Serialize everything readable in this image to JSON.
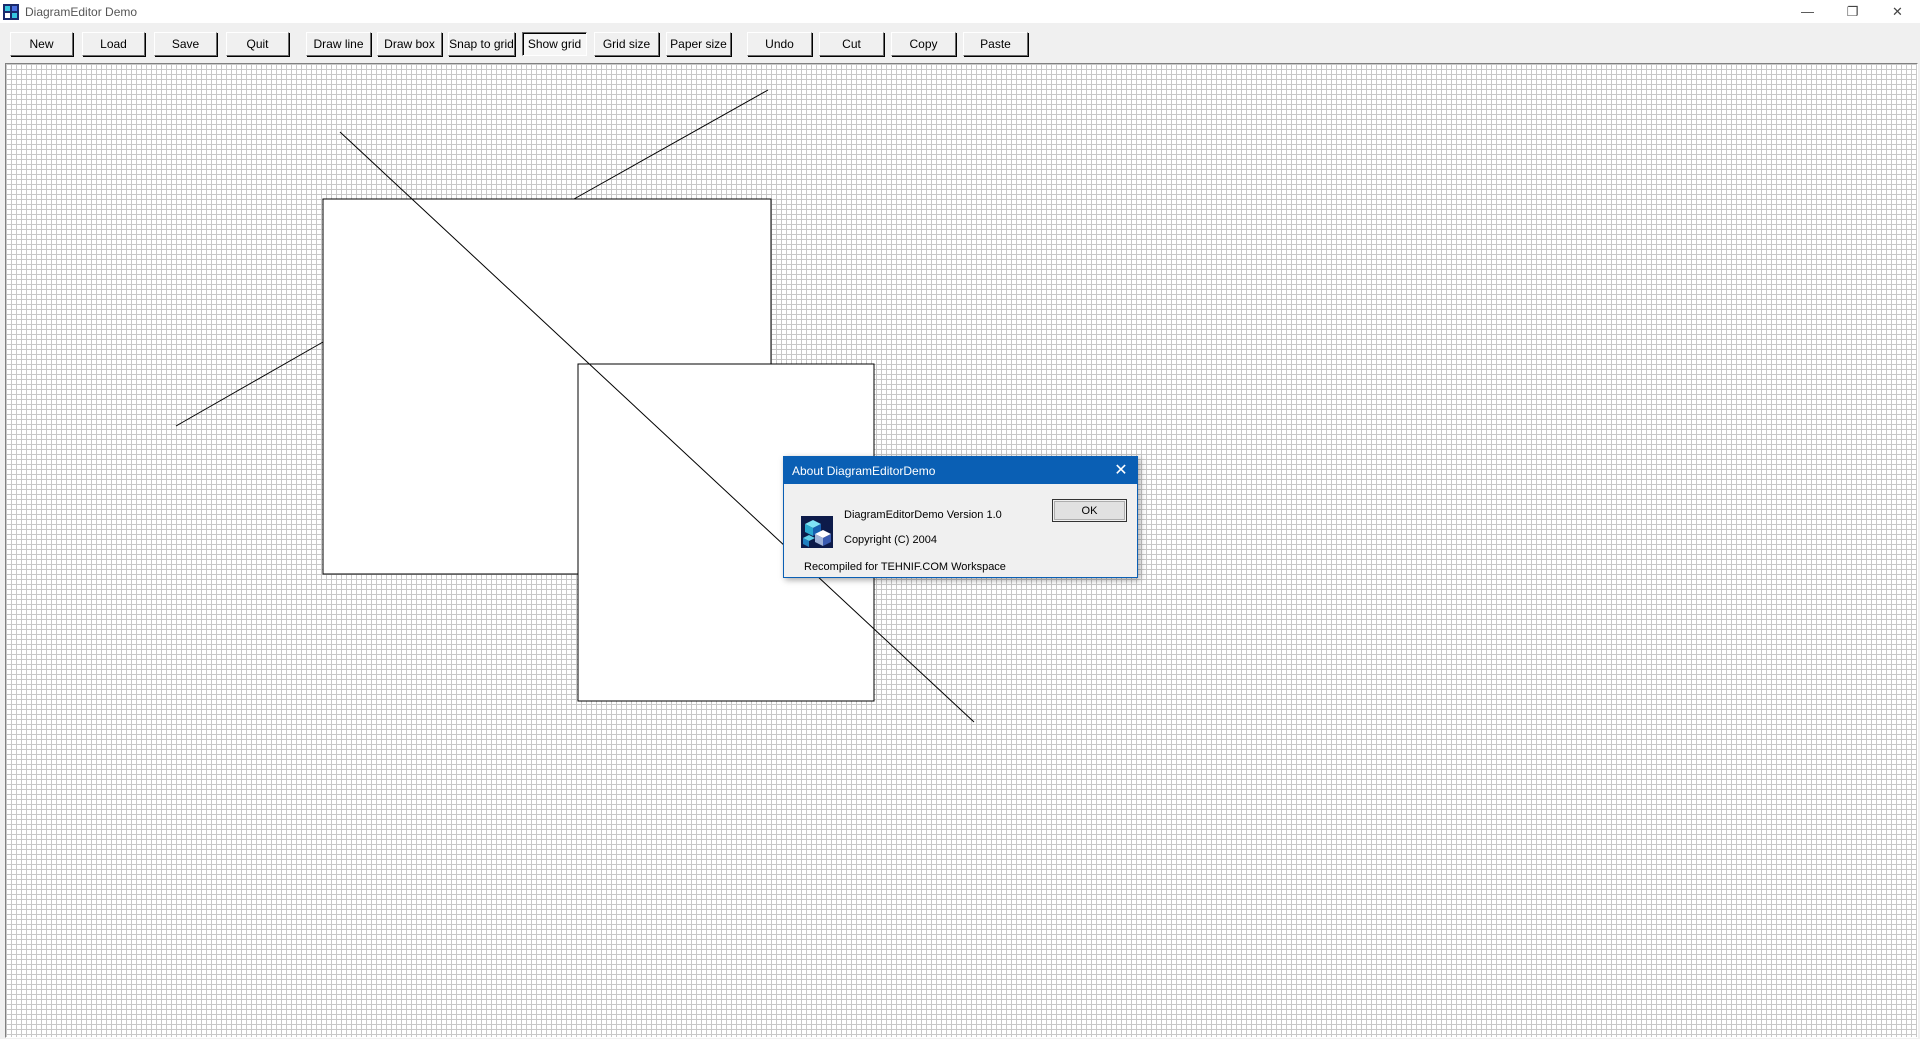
{
  "window": {
    "title": "DiagramEditor Demo",
    "caption": {
      "minimize": "—",
      "restore": "❐",
      "close": "✕"
    }
  },
  "toolbar": {
    "buttons": [
      {
        "label": "New",
        "pressed": false
      },
      {
        "label": "Load",
        "pressed": false
      },
      {
        "label": "Save",
        "pressed": false
      },
      {
        "label": "Quit",
        "pressed": false
      },
      {
        "label": "Draw line",
        "pressed": false
      },
      {
        "label": "Draw box",
        "pressed": false
      },
      {
        "label": "Snap to grid",
        "pressed": false
      },
      {
        "label": "Show grid",
        "pressed": true
      },
      {
        "label": "Grid size",
        "pressed": false
      },
      {
        "label": "Paper size",
        "pressed": false
      },
      {
        "label": "Undo",
        "pressed": false
      },
      {
        "label": "Cut",
        "pressed": false
      },
      {
        "label": "Copy",
        "pressed": false
      },
      {
        "label": "Paste",
        "pressed": false
      }
    ]
  },
  "about": {
    "title": "About DiagramEditorDemo",
    "close": "✕",
    "version": "DiagramEditorDemo Version 1.0",
    "copyright": "Copyright (C) 2004",
    "note": "Recompiled for TEHNIF.COM Workspace",
    "ok_label": "OK"
  },
  "colors": {
    "dialog_title_bg": "#0a5fb4",
    "grid_line": "#c8c8c8",
    "canvas_bg": "#ffffff"
  },
  "icons": {
    "app": "diagram-cubes-icon",
    "dialog": "diagram-cubes-icon"
  }
}
